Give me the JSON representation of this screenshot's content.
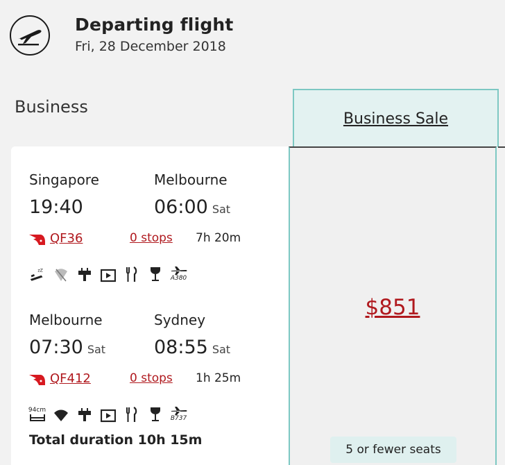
{
  "header": {
    "icon": "flight-departure-icon",
    "title": "Departing flight",
    "date": "Fri, 28 December 2018"
  },
  "cabin_label": "Business",
  "fare": {
    "name": "Business Sale",
    "price": "$851",
    "availability": "5 or fewer seats"
  },
  "segments": [
    {
      "from_city": "Singapore",
      "to_city": "Melbourne",
      "depart_time": "19:40",
      "depart_day": "",
      "arrive_time": "06:00",
      "arrive_day": "Sat",
      "flight_number": "QF36",
      "stops": "0 stops",
      "duration": "7h 20m",
      "aircraft": "A380",
      "amenities": [
        "lie-flat-bed-icon",
        "wifi-unavailable-icon",
        "power-icon",
        "entertainment-icon",
        "dining-icon",
        "drinks-icon",
        "aircraft-icon"
      ]
    },
    {
      "from_city": "Melbourne",
      "to_city": "Sydney",
      "depart_time": "07:30",
      "depart_day": "Sat",
      "arrive_time": "08:55",
      "arrive_day": "Sat",
      "flight_number": "QF412",
      "stops": "0 stops",
      "duration": "1h 25m",
      "aircraft": "B737",
      "seat_pitch": "94cm",
      "amenities": [
        "seat-pitch-icon",
        "wifi-icon",
        "power-icon",
        "entertainment-icon",
        "dining-icon",
        "drinks-icon",
        "aircraft-icon"
      ]
    }
  ],
  "total_duration": "Total duration 10h 15m",
  "colors": {
    "accent_red": "#b0191e",
    "teal_border": "#7dc8c3",
    "teal_fill": "#e3f2f1"
  }
}
